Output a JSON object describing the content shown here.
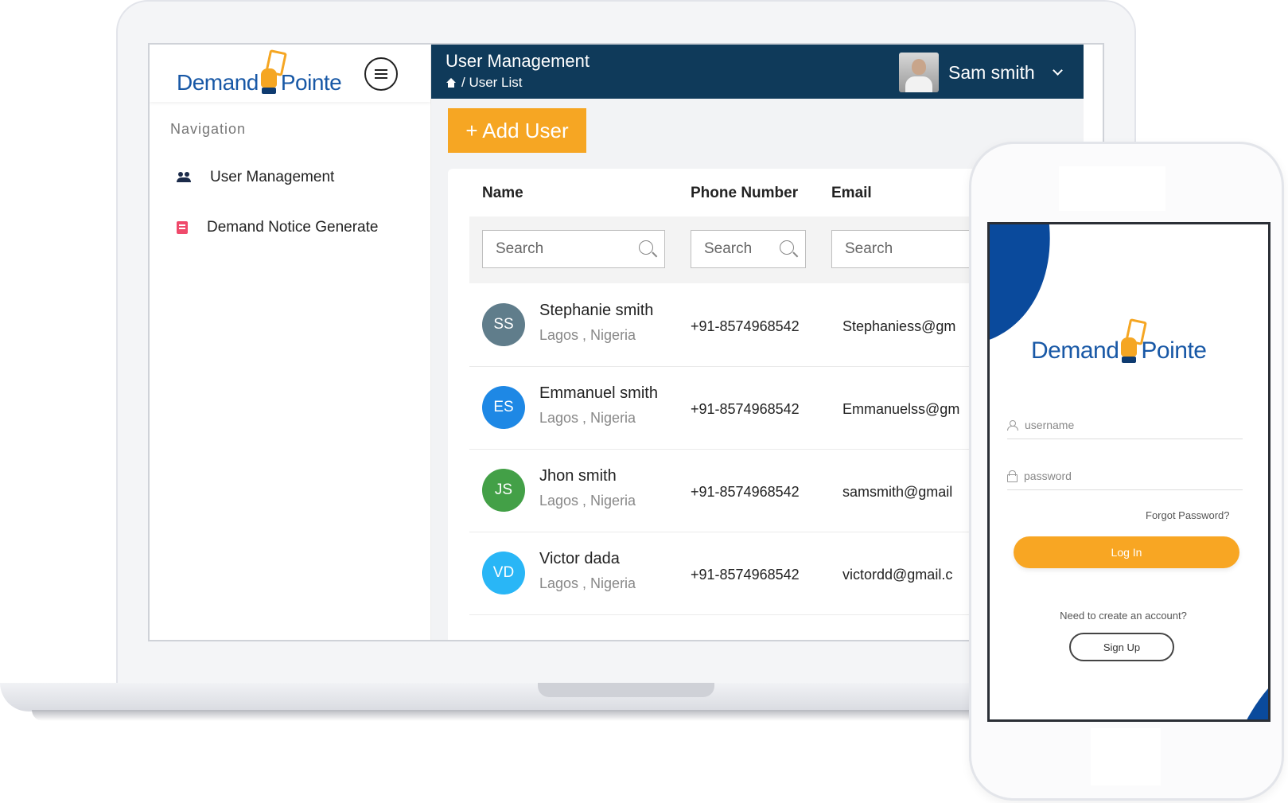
{
  "brand": {
    "name_left": "Demand",
    "name_right": "Pointe",
    "color": "#1858a6",
    "accent": "#f6a623"
  },
  "sidebar": {
    "nav_title": "Navigation",
    "items": [
      {
        "label": "User Management",
        "icon": "users-icon"
      },
      {
        "label": "Demand Notice Generate",
        "icon": "document-icon"
      }
    ]
  },
  "header": {
    "title": "User Management",
    "breadcrumb": "/ User List",
    "user_name": "Sam smith",
    "bg": "#0f3a5a"
  },
  "toolbar": {
    "add_user_label": "+ Add User"
  },
  "table": {
    "columns": [
      "Name",
      "Phone Number",
      "Email"
    ],
    "search_placeholder": "Search",
    "rows": [
      {
        "initials": "SS",
        "name": "Stephanie smith",
        "location": "Lagos , Nigeria",
        "phone": "+91-8574968542",
        "email": "Stephaniess@gm",
        "avatar_color": "#607d8b"
      },
      {
        "initials": "ES",
        "name": "Emmanuel smith",
        "location": "Lagos , Nigeria",
        "phone": "+91-8574968542",
        "email": "Emmanuelss@gm",
        "avatar_color": "#1e88e5"
      },
      {
        "initials": "JS",
        "name": "Jhon smith",
        "location": "Lagos , Nigeria",
        "phone": "+91-8574968542",
        "email": "samsmith@gmail",
        "avatar_color": "#43a047"
      },
      {
        "initials": "VD",
        "name": "Victor dada",
        "location": "Lagos , Nigeria",
        "phone": "+91-8574968542",
        "email": "victordd@gmail.c",
        "avatar_color": "#29b6f6"
      }
    ]
  },
  "mobile": {
    "username_placeholder": "username",
    "password_placeholder": "password",
    "forgot_label": "Forgot Password?",
    "login_label": "Log In",
    "need_account": "Need to create an account?",
    "signup_label": "Sign Up"
  }
}
